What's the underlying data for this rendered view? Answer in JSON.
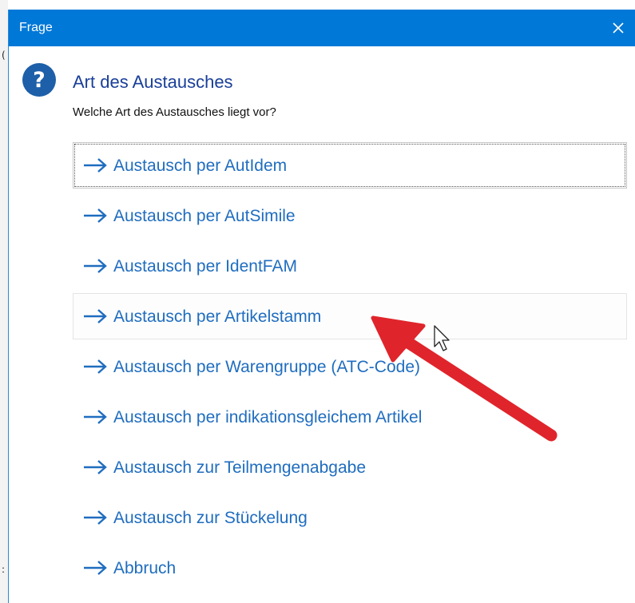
{
  "window": {
    "title": "Frage"
  },
  "dialog": {
    "heading": "Art des Austausches",
    "question": "Welche Art des Austausches liegt vor?",
    "options": [
      {
        "label": "Austausch per AutIdem"
      },
      {
        "label": "Austausch per AutSimile"
      },
      {
        "label": "Austausch per IdentFAM"
      },
      {
        "label": "Austausch per Artikelstamm"
      },
      {
        "label": "Austausch per Warengruppe (ATC-Code)"
      },
      {
        "label": "Austausch per indikationsgleichem Artikel"
      },
      {
        "label": "Austausch zur Teilmengenabgabe"
      },
      {
        "label": "Austausch zur Stückelung"
      },
      {
        "label": "Abbruch"
      }
    ]
  },
  "icons": {
    "close": "close-icon",
    "question": "question-icon",
    "option": "arrow-right-icon",
    "cursor": "mouse-pointer-icon"
  },
  "colors": {
    "titlebar": "#0078d7",
    "link": "#1f6dbf",
    "heading": "#1a3f99",
    "annotation_arrow": "#e0242b"
  }
}
